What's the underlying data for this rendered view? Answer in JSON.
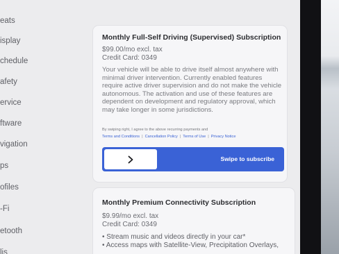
{
  "sidebar": {
    "items": [
      {
        "label": "eats"
      },
      {
        "label": "isplay"
      },
      {
        "label": "chedule"
      },
      {
        "label": "afety"
      },
      {
        "label": "ervice"
      },
      {
        "label": "ftware"
      },
      {
        "label": "vigation"
      },
      {
        "label": "ps"
      },
      {
        "label": "ofiles"
      },
      {
        "label": "-Fi"
      },
      {
        "label": "etooth"
      },
      {
        "label": "lis"
      }
    ]
  },
  "fsd": {
    "title": "Monthly Full-Self Driving (Supervised) Subscription",
    "price": "$99.00/mo excl. tax",
    "card": "Credit Card: 0349",
    "description": "Your vehicle will be able to drive itself almost anywhere with minimal driver intervention. Currently enabled features require active driver supervision and do not make the vehicle autonomous. The activation and use of these features are dependent on development and regulatory approval, which may take longer in some jurisdictions.",
    "legal": "By swiping right, I agree to the above recurring payments and",
    "links": [
      "Terms and Conditions",
      "Cancellation Policy",
      "Terms of Use",
      "Privacy Notice"
    ],
    "swipe_label": "Swipe to subscribe",
    "accent": "#3a62d6"
  },
  "connectivity": {
    "title": "Monthly Premium Connectivity Subscription",
    "price": "$9.99/mo excl. tax",
    "card": "Credit Card: 0349",
    "bullets": [
      "Stream music and videos directly in your car*",
      "Access maps with Satellite-View, Precipitation Overlays,"
    ]
  }
}
